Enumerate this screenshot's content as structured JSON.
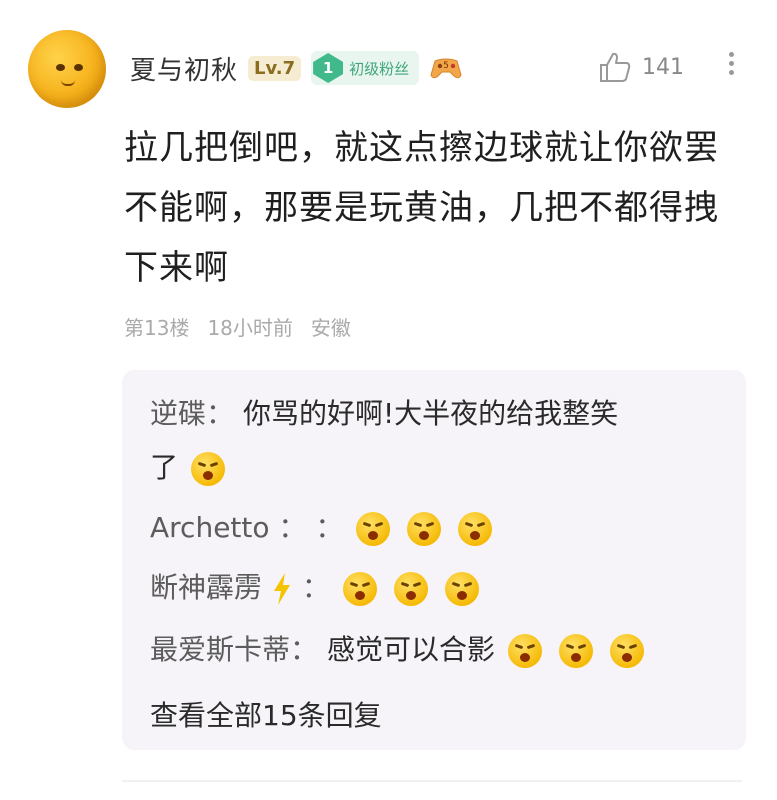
{
  "comment": {
    "username": "夏与初秋",
    "level": "Lv.7",
    "fan_badge": {
      "level": "1",
      "label": "初级粉丝"
    },
    "like_count": "141",
    "text_line1": "拉几把倒吧，就这点擦边球就让你欲罢",
    "text_line2": "不能啊，那要是玩黄油，几把不都得拽",
    "text_line3": "下来啊",
    "floor": "第13楼",
    "time": "18小时前",
    "location": "安徽"
  },
  "replies": [
    {
      "name": "逆碟",
      "text": "你骂的好啊!大半夜的给我整笑",
      "text2": "了"
    },
    {
      "name": "Archetto",
      "separator": "：",
      "text": ""
    },
    {
      "name": "断神霹雳",
      "separator": "：",
      "text": ""
    },
    {
      "name": "最爱斯卡蒂",
      "separator": "：",
      "text": "感觉可以合影"
    }
  ],
  "reply_colon": "：",
  "view_all": "查看全部15条回复",
  "icons": {
    "like": "thumbs-up-icon",
    "more": "more-vertical-icon",
    "gamepad": "gamepad-icon",
    "emoji": "laughing-emoji-icon",
    "lightning": "lightning-icon"
  },
  "colors": {
    "fan_badge": "#41b98b",
    "level_badge": "#f5ecd2",
    "reply_bg": "#f6f4f9"
  }
}
